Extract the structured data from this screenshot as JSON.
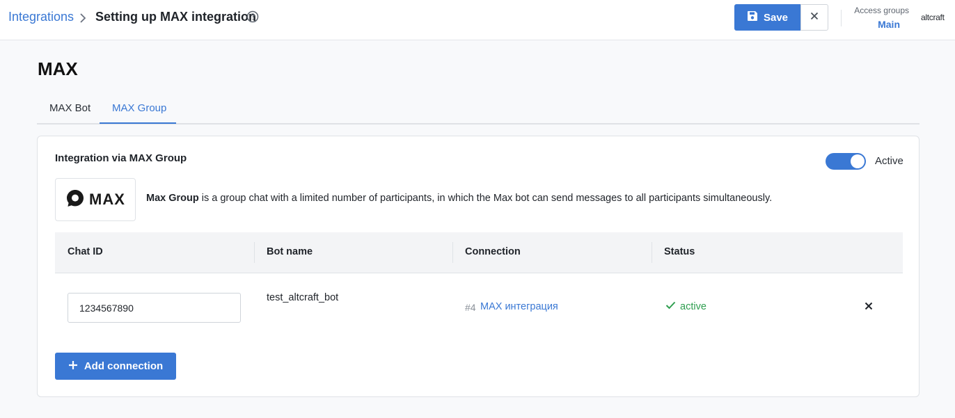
{
  "header": {
    "breadcrumb_link": "Integrations",
    "title": "Setting up MAX integration",
    "save_label": "Save",
    "access_groups_label": "Access groups",
    "access_groups_value": "Main",
    "logo_text": "altcraft"
  },
  "page": {
    "title": "MAX",
    "tabs": [
      {
        "label": "MAX Bot",
        "active": false
      },
      {
        "label": "MAX Group",
        "active": true
      }
    ]
  },
  "card": {
    "title": "Integration via MAX Group",
    "toggle_label": "Active",
    "toggle_on": true,
    "brand_text": "MAX",
    "description_bold": "Max Group",
    "description_rest": " is a group chat with a limited number of participants, in which the Max bot can send messages to all participants simultaneously.",
    "table": {
      "columns": [
        "Chat ID",
        "Bot name",
        "Connection",
        "Status"
      ],
      "rows": [
        {
          "chat_id": "1234567890",
          "bot_name": "test_altcraft_bot",
          "connection_num": "#4",
          "connection_name": "MAX интеграция",
          "status": "active"
        }
      ]
    },
    "add_button_label": "Add connection"
  },
  "colors": {
    "accent": "#3a78d4",
    "success": "#2e9e4f",
    "muted": "#8a9099"
  },
  "icons": [
    "chevron-right-icon",
    "help-circle-icon",
    "floppy-disk-icon",
    "close-icon",
    "max-logo-icon",
    "check-icon",
    "plus-icon"
  ]
}
